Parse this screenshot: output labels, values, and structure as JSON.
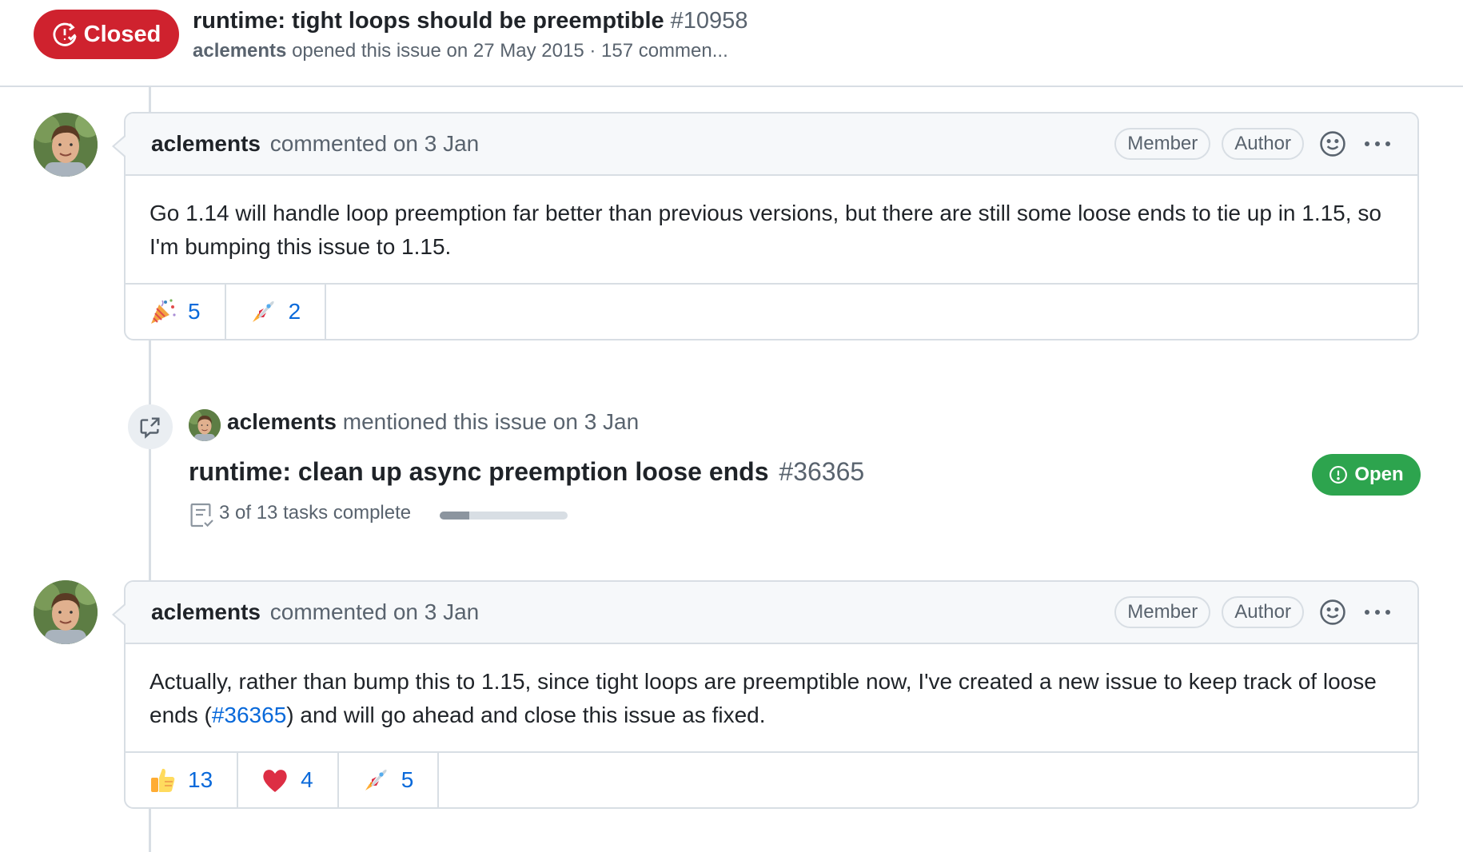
{
  "header": {
    "status_label": "Closed",
    "title": "runtime: tight loops should be preemptible",
    "number": "#10958",
    "author": "aclements",
    "meta_rest": "opened this issue on 27 May 2015 · 157 commen..."
  },
  "comments": [
    {
      "author": "aclements",
      "action": "commented on 3 Jan",
      "badges": [
        "Member",
        "Author"
      ],
      "body_segments": [
        "Go 1.14 will handle loop preemption far better than previous versions, but there are still some loose ends to tie up in 1.15, so I'm bumping this issue to 1.15."
      ],
      "reactions": [
        {
          "icon": "party-popper-icon",
          "count": "5"
        },
        {
          "icon": "rocket-icon",
          "count": "2"
        }
      ]
    },
    {
      "author": "aclements",
      "action": "commented on 3 Jan",
      "badges": [
        "Member",
        "Author"
      ],
      "body_before": "Actually, rather than bump this to 1.15, since tight loops are preemptible now, I've created a new issue to keep track of loose ends (",
      "body_link": "#36365",
      "body_after": ") and will go ahead and close this issue as fixed.",
      "reactions": [
        {
          "icon": "thumbs-up-icon",
          "count": "13"
        },
        {
          "icon": "heart-icon",
          "count": "4"
        },
        {
          "icon": "rocket-icon",
          "count": "5"
        }
      ]
    }
  ],
  "mention": {
    "author": "aclements",
    "action": "mentioned this issue on 3 Jan",
    "ref_title": "runtime: clean up async preemption loose ends",
    "ref_number": "#36365",
    "status_label": "Open",
    "tasks_text": "3 of 13 tasks complete",
    "tasks_progress": 0.23
  },
  "colors": {
    "closed": "#cf222e",
    "open": "#2da44e",
    "link": "#0969da"
  }
}
